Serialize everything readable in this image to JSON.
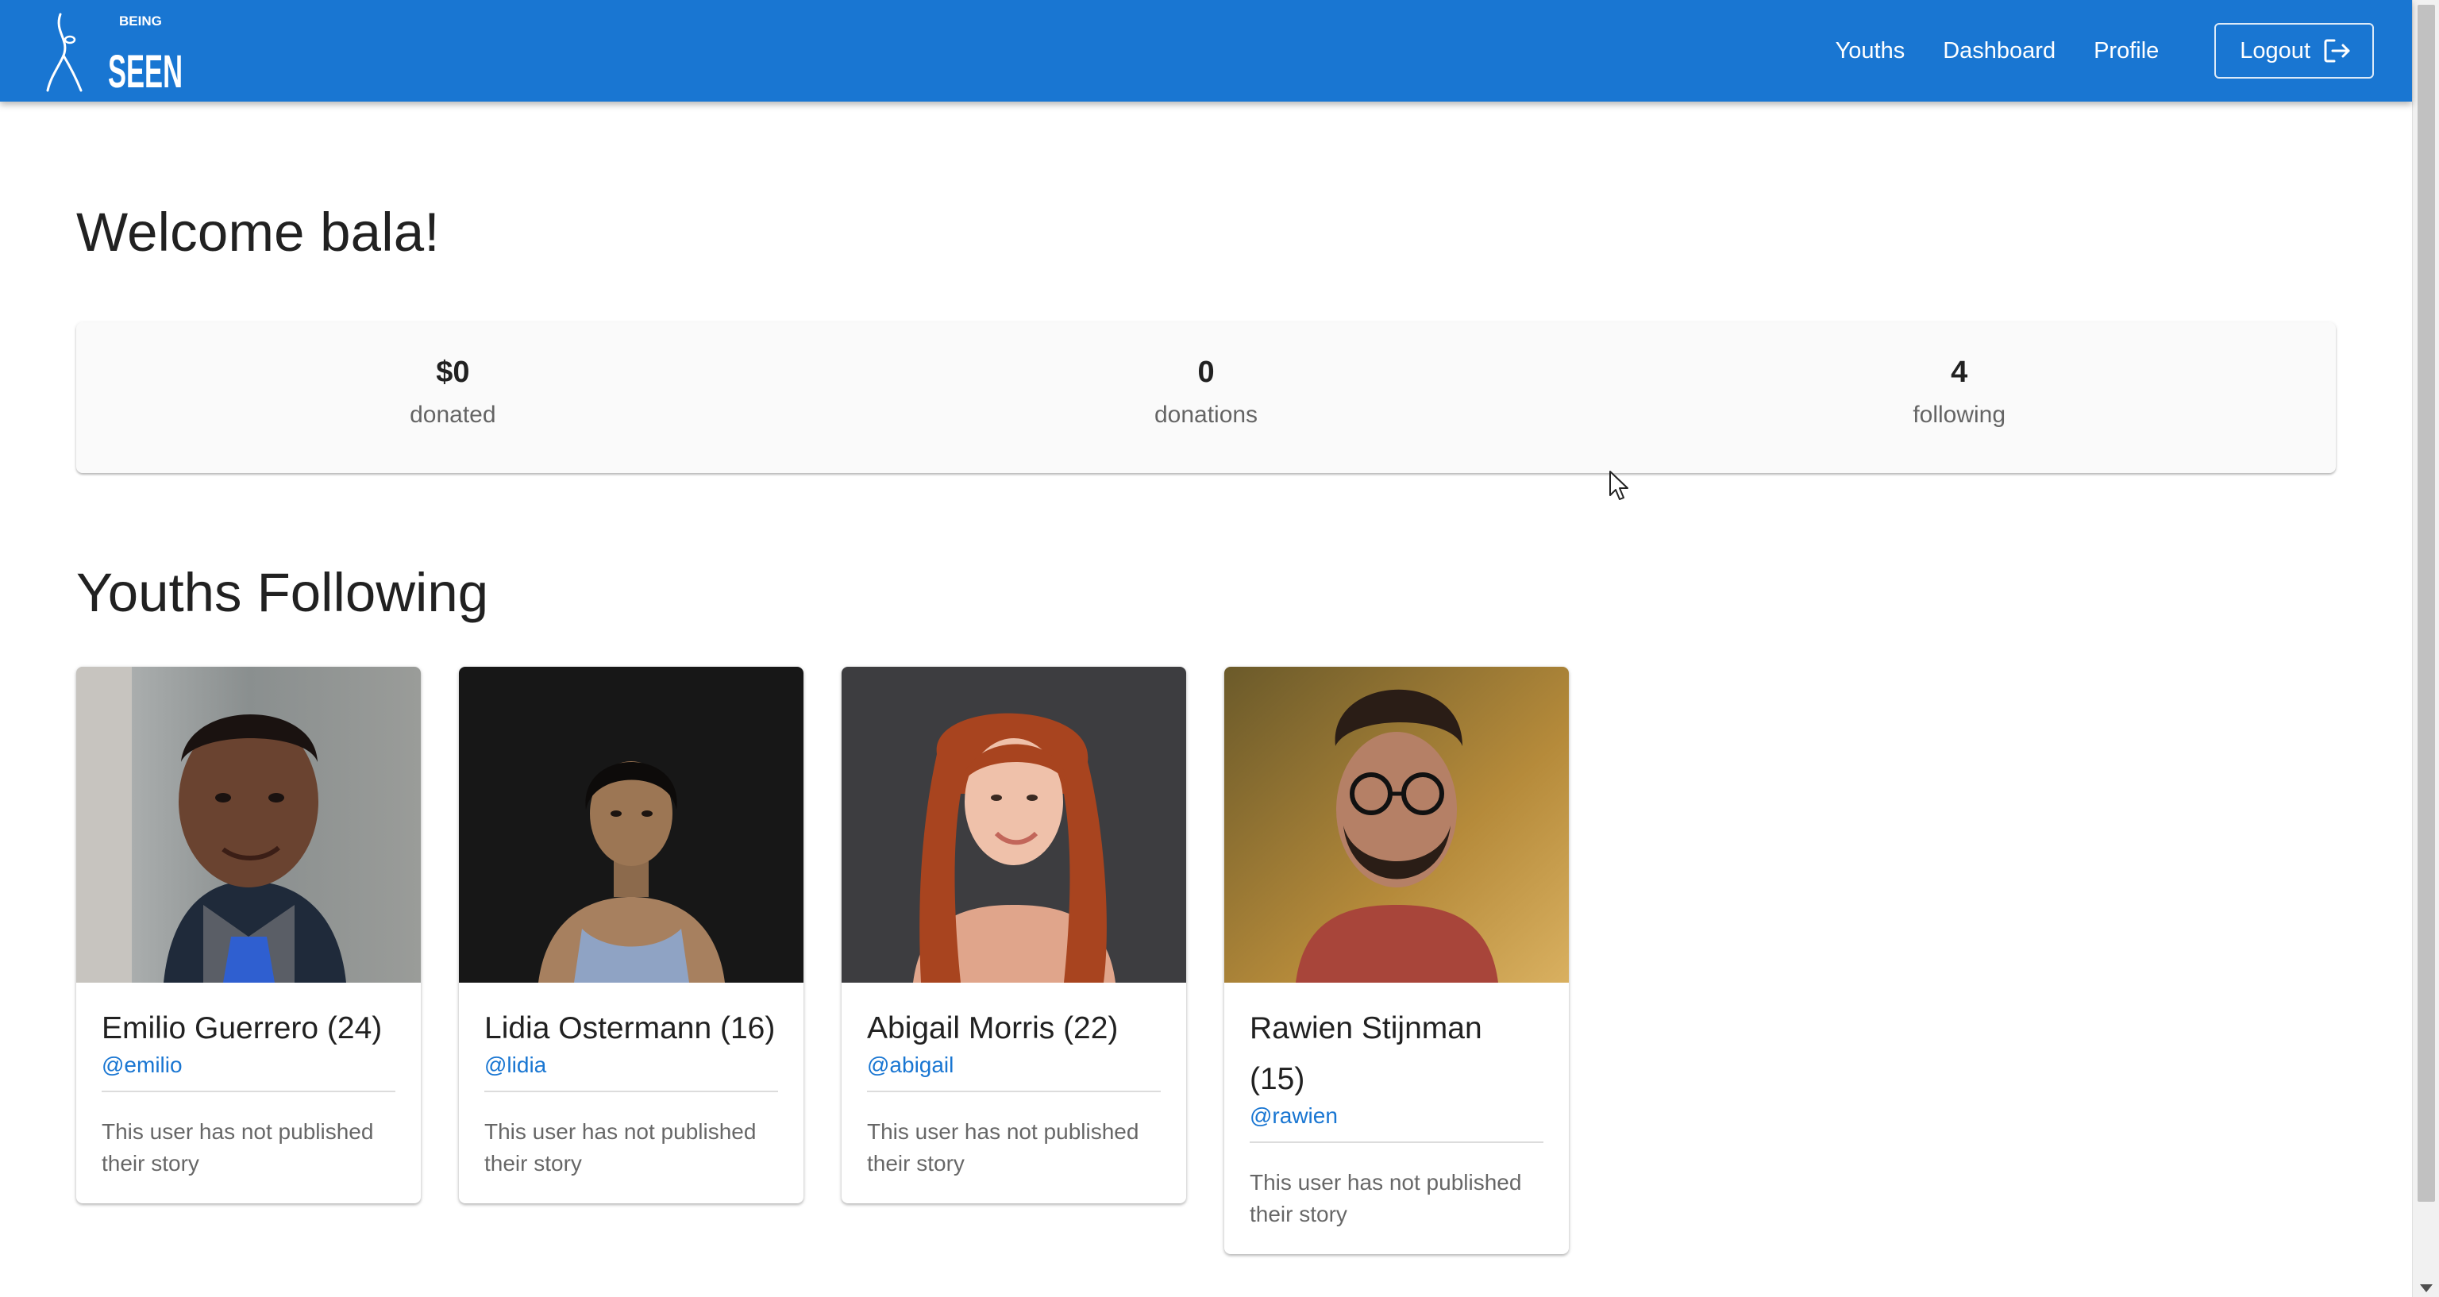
{
  "app": {
    "logo_text_small": "BEING",
    "logo_text_large": "SEEN",
    "brand_color": "#1976d2"
  },
  "nav": {
    "items": [
      {
        "label": "Youths"
      },
      {
        "label": "Dashboard"
      },
      {
        "label": "Profile"
      }
    ],
    "logout_label": "Logout",
    "logout_icon": "logout-icon"
  },
  "welcome": {
    "title": "Welcome bala!"
  },
  "stats": [
    {
      "value": "$0",
      "label": "donated"
    },
    {
      "value": "0",
      "label": "donations"
    },
    {
      "value": "4",
      "label": "following"
    }
  ],
  "section": {
    "title": "Youths Following"
  },
  "youths": [
    {
      "name": "Emilio Guerrero (24)",
      "handle": "@emilio",
      "story": "This user has not published their story"
    },
    {
      "name": "Lidia Ostermann (16)",
      "handle": "@lidia",
      "story": "This user has not published their story"
    },
    {
      "name": "Abigail Morris (22)",
      "handle": "@abigail",
      "story": "This user has not published their story"
    },
    {
      "name": "Rawien Stijnman (15)",
      "handle": "@rawien",
      "story": "This user has not published their story"
    }
  ]
}
